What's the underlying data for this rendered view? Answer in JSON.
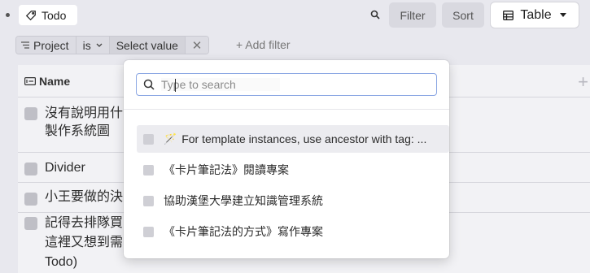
{
  "toolbar": {
    "tag_label": "Todo",
    "filter_label": "Filter",
    "sort_label": "Sort",
    "view_label": "Table"
  },
  "filter": {
    "field_label": "Project",
    "operator_label": "is",
    "value_placeholder": "Select value",
    "remove_label": "✕",
    "add_filter_label": "+ Add filter"
  },
  "table": {
    "name_header": "Name",
    "add_column_label": "+",
    "rows": [
      {
        "text": "沒有說明用什\n製作系統圖"
      },
      {
        "text": "Divider"
      },
      {
        "text": "小王要做的決"
      },
      {
        "text": "記得去排隊買\n這裡又想到需\nTodo)"
      }
    ]
  },
  "dropdown": {
    "search_placeholder": "Type to search",
    "options": [
      {
        "label": "For template instances, use ancestor with tag: ...",
        "icon": "magic-wand-icon"
      },
      {
        "label": "《卡片筆記法》閱讀專案"
      },
      {
        "label": "協助漢堡大學建立知識管理系統"
      },
      {
        "label": "《卡片筆記法的方式》寫作專案"
      }
    ]
  },
  "colors": {
    "background": "#e8e8ee",
    "focus_border": "#8aa6e3",
    "checkbox": "#bfbfc6"
  }
}
